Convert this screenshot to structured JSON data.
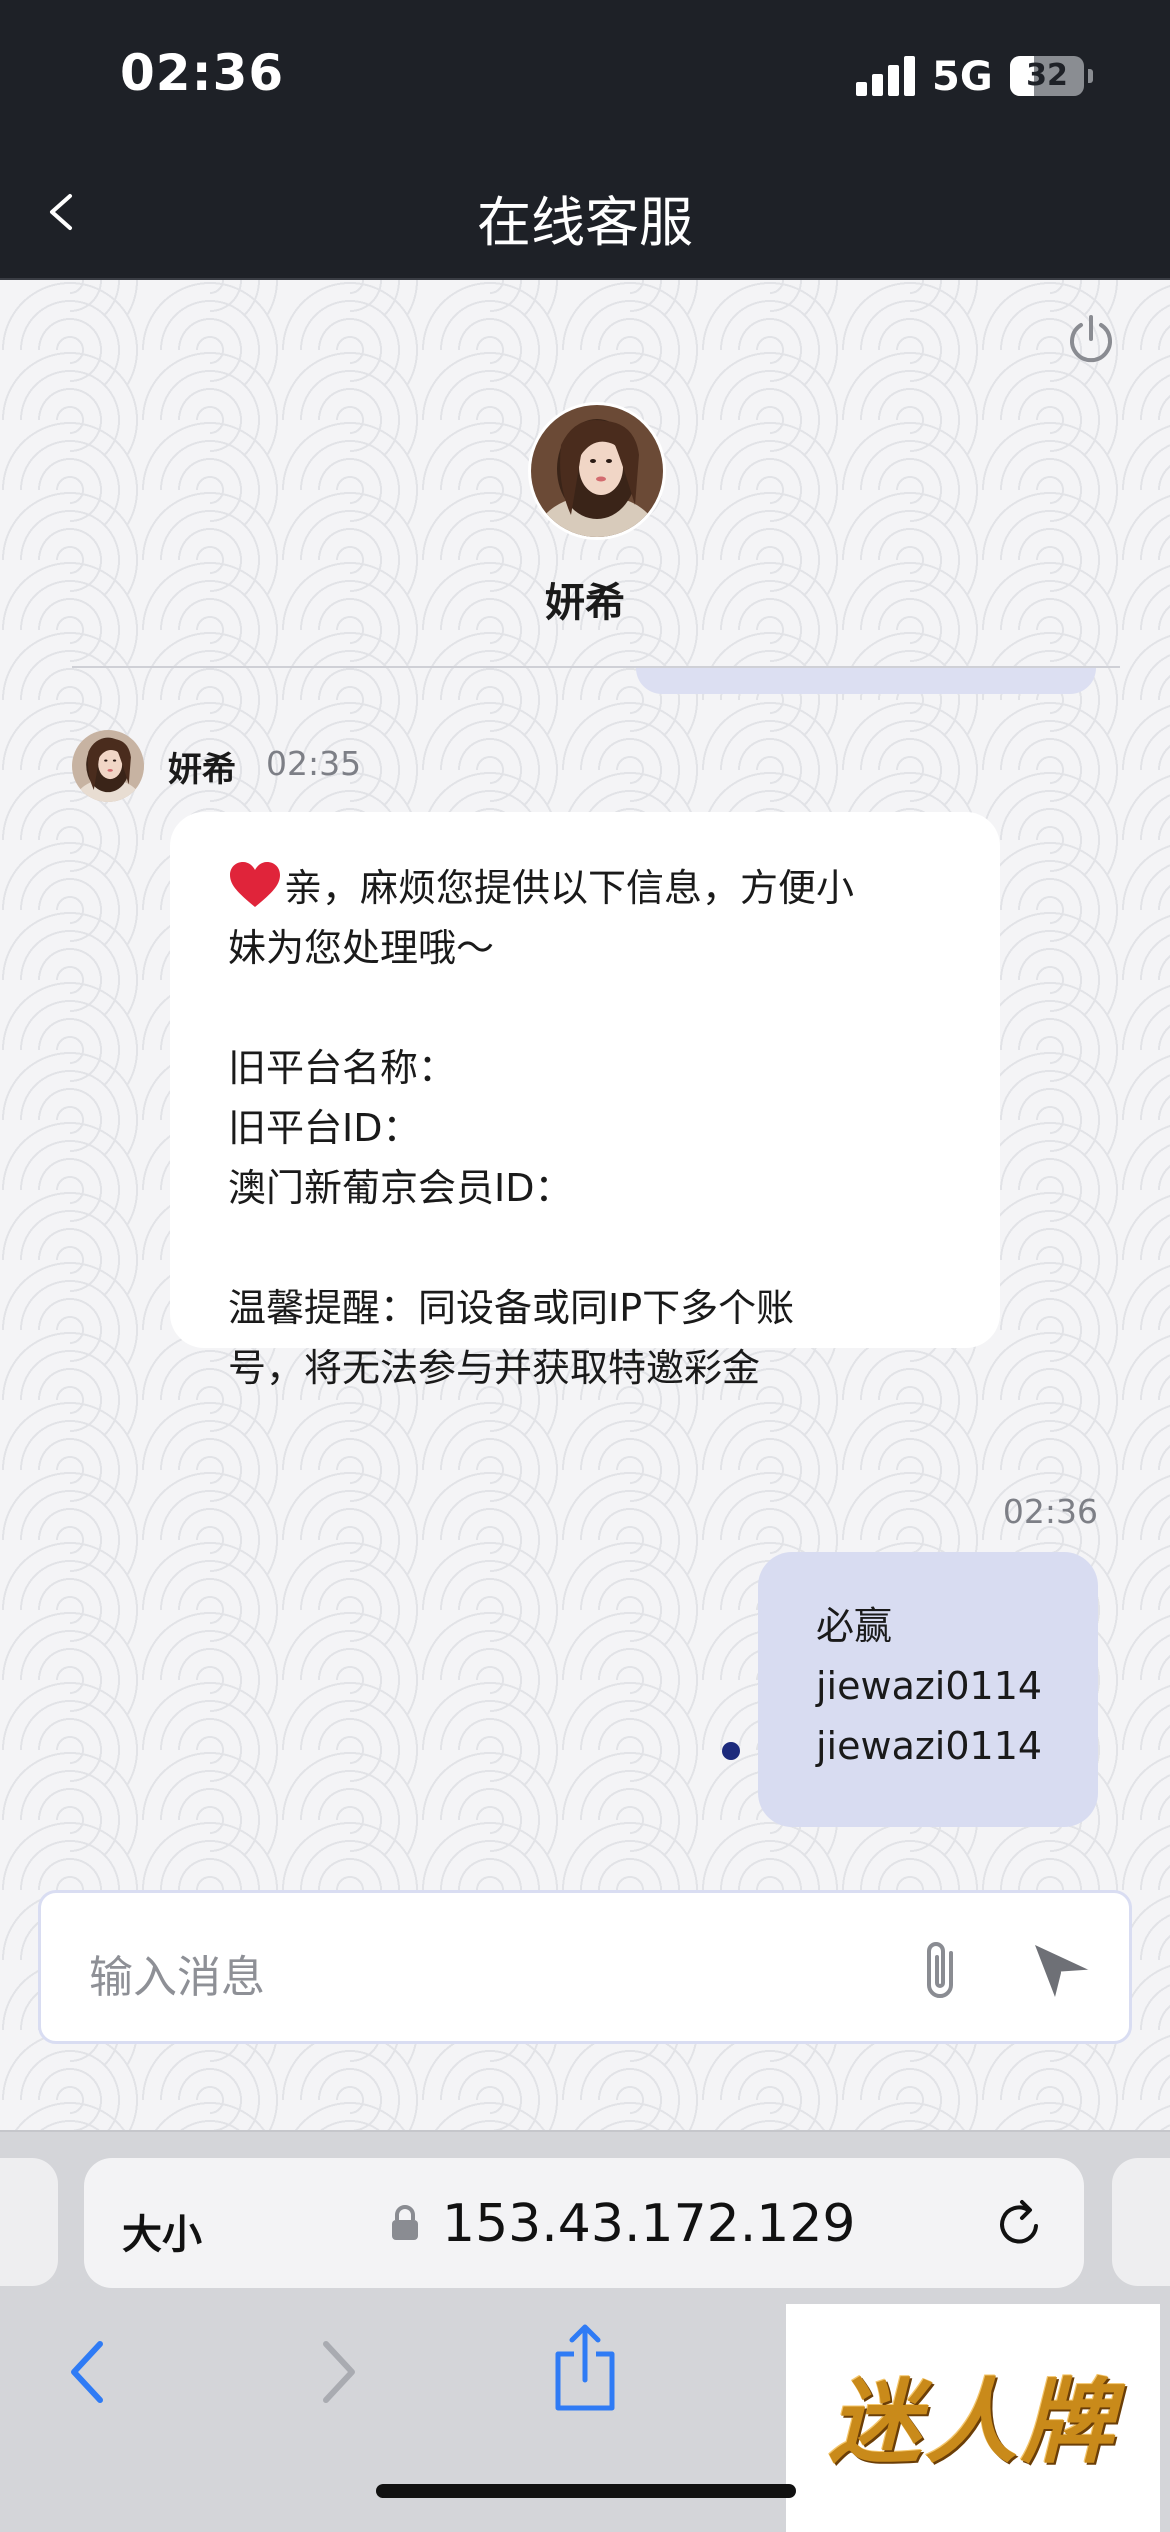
{
  "status_bar": {
    "time": "02:36",
    "network": "5G",
    "battery": "32",
    "battery_level": 0.32
  },
  "header": {
    "title": "在线客服"
  },
  "agent": {
    "name": "妍希"
  },
  "messages": {
    "incoming": {
      "sender": "妍希",
      "time": "02:35",
      "lines": [
        "亲，麻烦您提供以下信息，方便小",
        "妹为您处理哦～",
        "",
        "旧平台名称：",
        "旧平台ID：",
        "澳门新葡京会员ID：",
        "",
        "温馨提醒：同设备或同IP下多个账",
        "号，将无法参与并获取特邀彩金"
      ]
    },
    "outgoing": {
      "time": "02:36",
      "lines": [
        "必赢",
        "jiewazi0114",
        "jiewazi0114"
      ]
    }
  },
  "composer": {
    "placeholder": "输入消息"
  },
  "browser": {
    "text_size_label": "大小",
    "url": "153.43.172.129"
  },
  "watermark": {
    "text": "迷人牌"
  },
  "colors": {
    "header_bg": "#1e2127",
    "outgoing_bubble": "#d8dcf1",
    "sent_dot": "#1c2a7c",
    "heart": "#e0243a"
  }
}
